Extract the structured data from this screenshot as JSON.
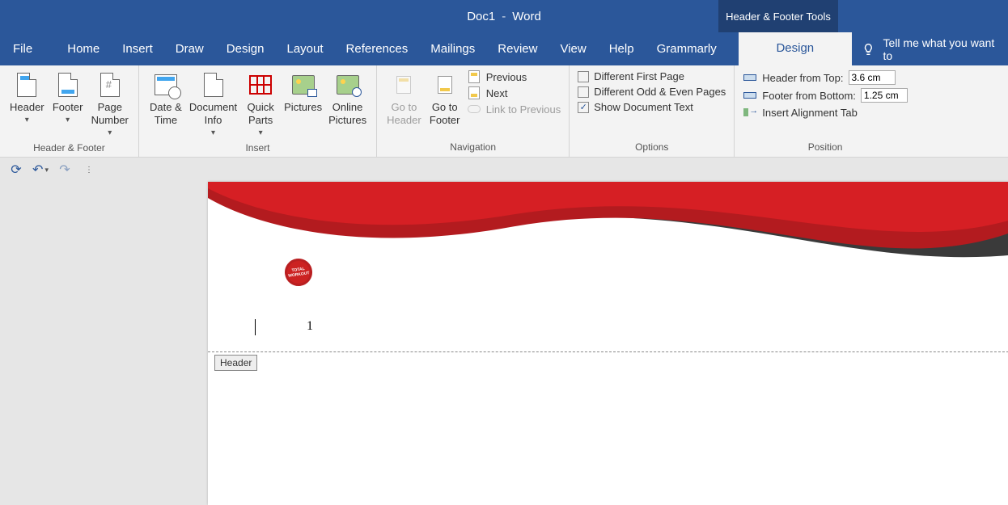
{
  "titlebar": {
    "doc": "Doc1",
    "app": "Word",
    "context_tab": "Header & Footer Tools"
  },
  "tabs": {
    "file": "File",
    "home": "Home",
    "insert": "Insert",
    "draw": "Draw",
    "design_main": "Design",
    "layout": "Layout",
    "references": "References",
    "mailings": "Mailings",
    "review": "Review",
    "view": "View",
    "help": "Help",
    "grammarly": "Grammarly",
    "design_hf": "Design",
    "tell_me": "Tell me what you want to"
  },
  "ribbon": {
    "group_hf": "Header & Footer",
    "header": "Header",
    "footer": "Footer",
    "page_number": "Page\nNumber",
    "group_insert": "Insert",
    "date_time": "Date &\nTime",
    "doc_info": "Document\nInfo",
    "quick_parts": "Quick\nParts",
    "pictures": "Pictures",
    "online_pictures": "Online\nPictures",
    "group_nav": "Navigation",
    "goto_header": "Go to\nHeader",
    "goto_footer": "Go to\nFooter",
    "previous": "Previous",
    "next": "Next",
    "link_prev": "Link to Previous",
    "group_options": "Options",
    "diff_first": "Different First Page",
    "diff_oddeven": "Different Odd & Even Pages",
    "show_doc": "Show Document Text",
    "group_position": "Position",
    "hdr_from_top_lbl": "Header from Top:",
    "hdr_from_top_val": "3.6 cm",
    "ftr_from_bot_lbl": "Footer from Bottom:",
    "ftr_from_bot_val": "1.25 cm",
    "align_tab": "Insert Alignment Tab"
  },
  "options_state": {
    "diff_first": false,
    "diff_oddeven": false,
    "show_doc": true
  },
  "document": {
    "stamp_text": "TOTAL\nWORKOUT",
    "page_number": "1",
    "header_tag": "Header"
  }
}
